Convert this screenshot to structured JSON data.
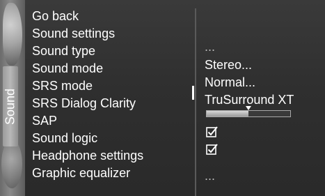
{
  "sidebar": {
    "tab_label": "Sound"
  },
  "menu": {
    "items": [
      {
        "label": "Go back"
      },
      {
        "label": "Sound settings"
      },
      {
        "label": "Sound type"
      },
      {
        "label": "Sound mode"
      },
      {
        "label": "SRS mode"
      },
      {
        "label": "SRS Dialog Clarity"
      },
      {
        "label": "SAP"
      },
      {
        "label": "Sound logic"
      },
      {
        "label": "Headphone settings"
      },
      {
        "label": "Graphic equalizer"
      }
    ],
    "selected_index": 4
  },
  "values": {
    "sound_settings": "...",
    "sound_type": "Stereo...",
    "sound_mode": "Normal...",
    "srs_mode": "TruSurround XT",
    "srs_dialog_clarity_level": 0.5,
    "sap_checked": true,
    "sound_logic_checked": true,
    "headphone_settings": "...",
    "graphic_equalizer": "..."
  },
  "colors": {
    "text": "#ffffff",
    "tab": "#b8b8b8",
    "background": "#2f2f2f"
  },
  "icons": {
    "checkbox": "checkbox-checked-icon",
    "slider_thumb": "triangle-down-icon"
  }
}
